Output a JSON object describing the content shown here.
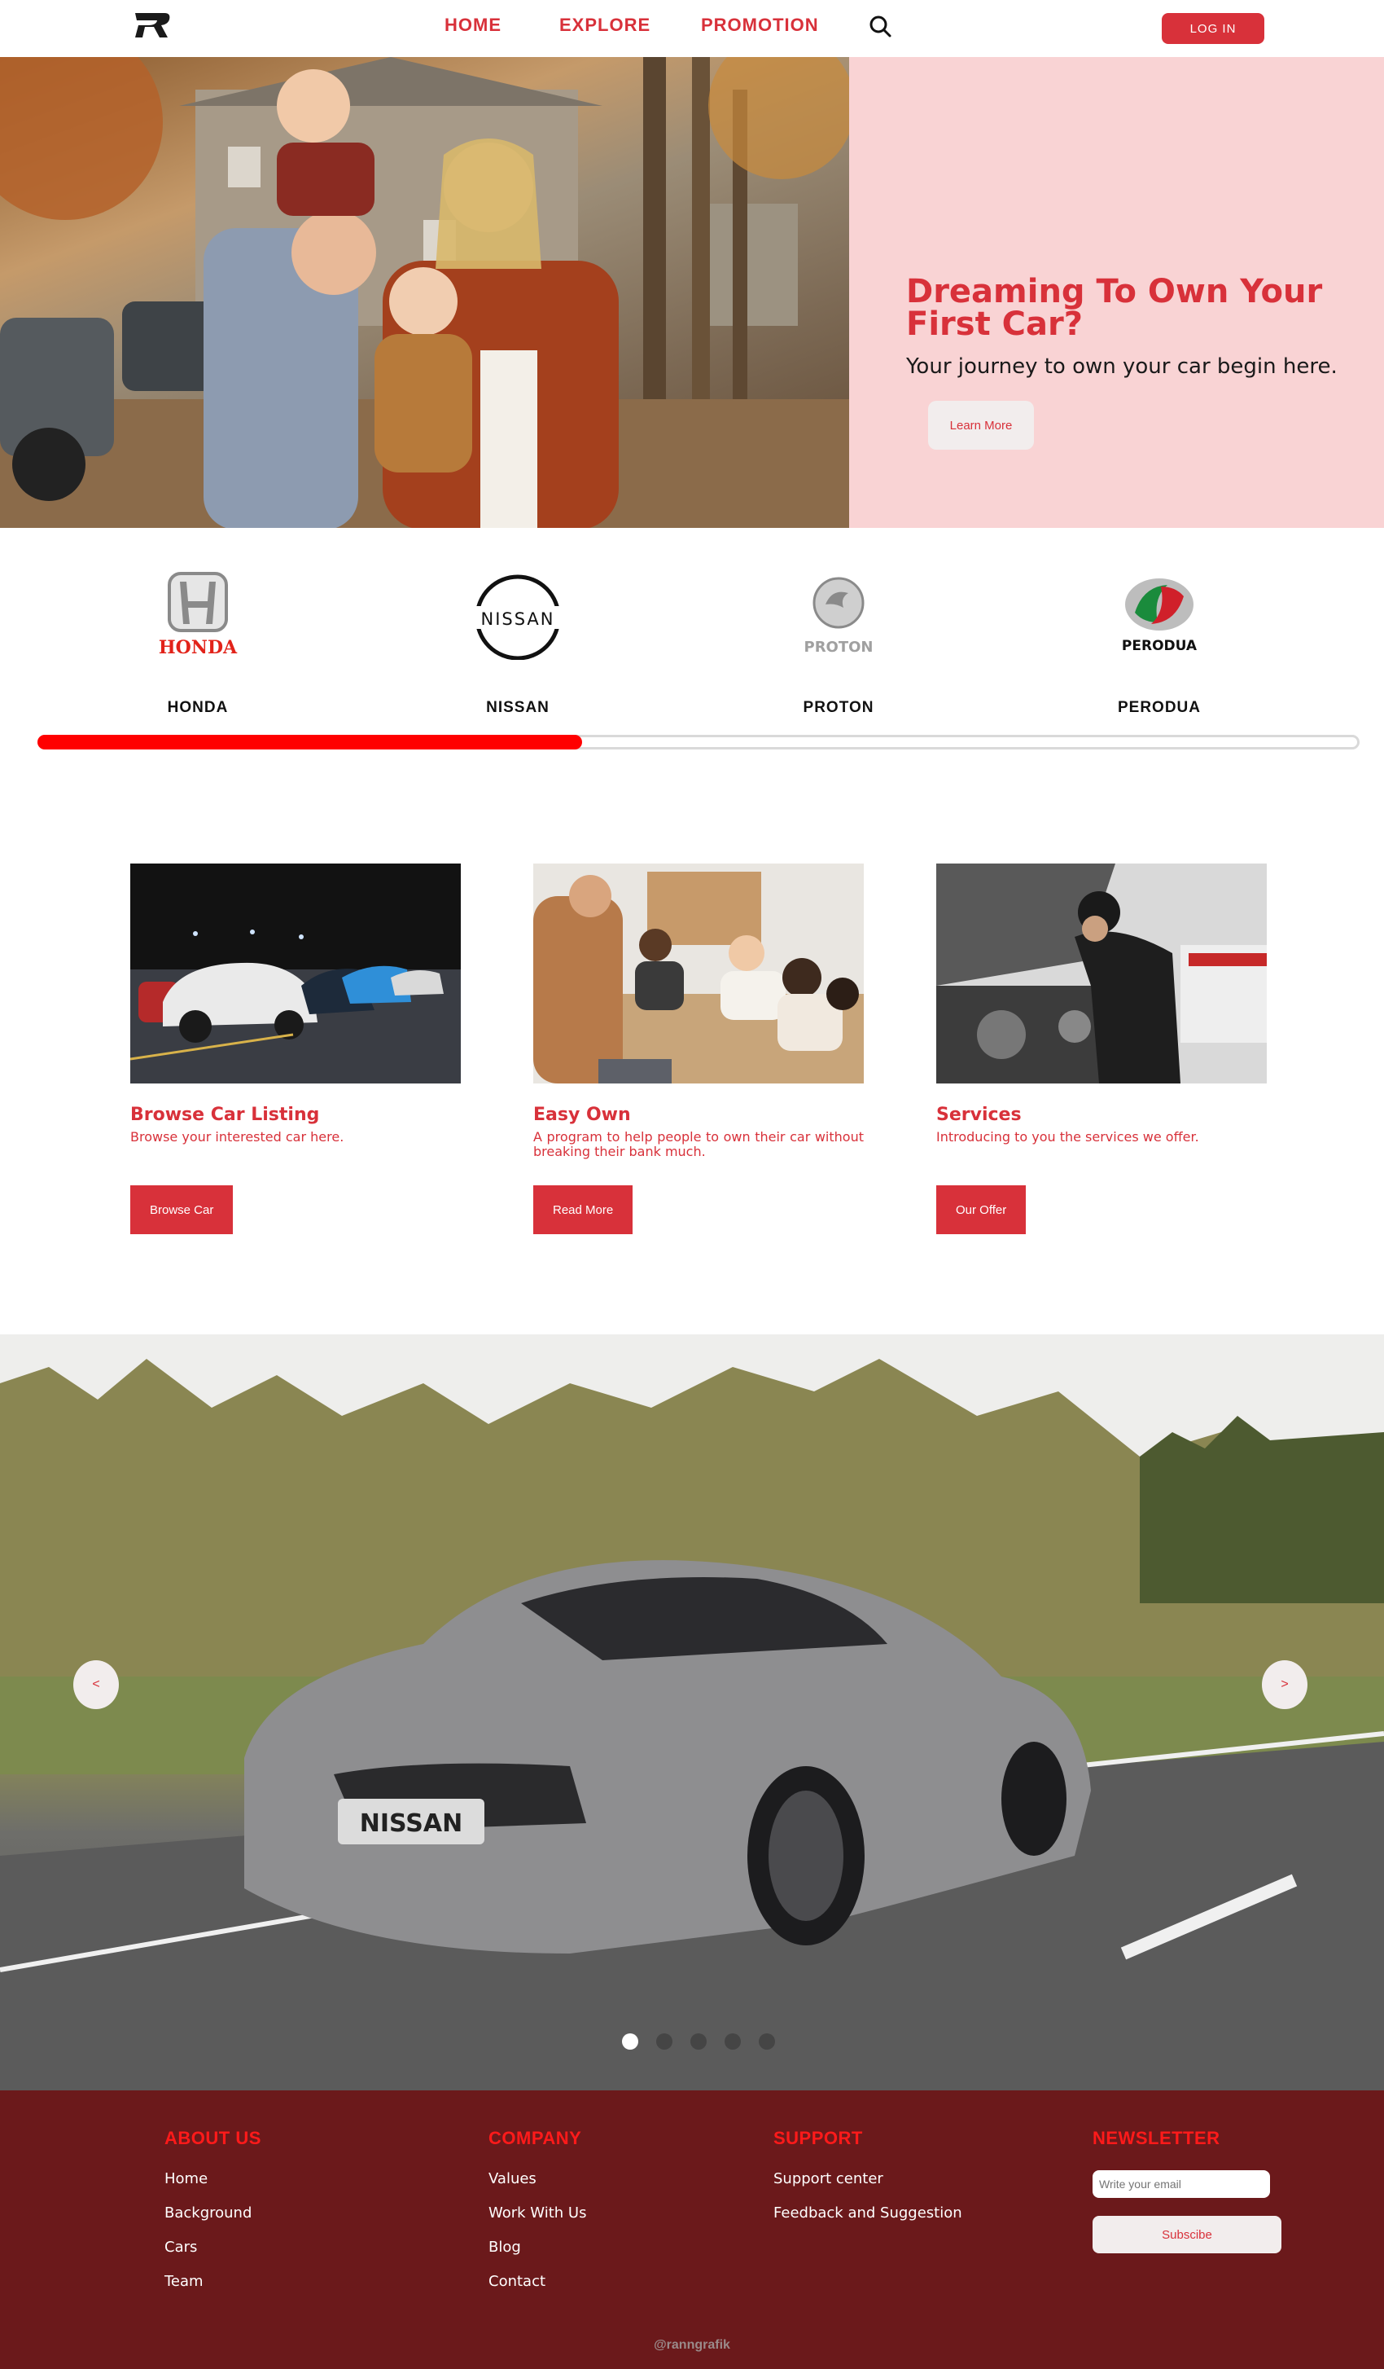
{
  "nav": {
    "home": "HOME",
    "explore": "EXPLORE",
    "promotion": "PROMOTION",
    "login": "LOG IN"
  },
  "hero": {
    "title": "Dreaming To Own Your First Car?",
    "subtitle": "Your journey to own your car begin here.",
    "button": "Learn More"
  },
  "brands": [
    {
      "name": "HONDA",
      "logo_text": "HONDA"
    },
    {
      "name": "NISSAN",
      "logo_text": "NISSAN"
    },
    {
      "name": "PROTON",
      "logo_text": "PROTON"
    },
    {
      "name": "PERODUA",
      "logo_text": "PERODUA"
    }
  ],
  "brand_progress": 0.41,
  "cards": [
    {
      "title": "Browse Car Listing",
      "desc": "Browse your interested car here.",
      "button": "Browse Car"
    },
    {
      "title": "Easy Own",
      "desc": "A program to help people to own their car without breaking their bank much.",
      "button": "Read More"
    },
    {
      "title": "Services",
      "desc": "Introducing to you the services we offer.",
      "button": "Our Offer"
    }
  ],
  "carousel": {
    "prev": "<",
    "next": ">",
    "plate": "NISSAN",
    "slide_count": 5,
    "active_slide": 1
  },
  "footer": {
    "about": {
      "heading": "ABOUT US",
      "links": [
        "Home",
        "Background",
        "Cars",
        "Team"
      ]
    },
    "company": {
      "heading": "COMPANY",
      "links": [
        "Values",
        "Work With Us",
        "Blog",
        "Contact"
      ]
    },
    "support": {
      "heading": "SUPPORT",
      "links": [
        "Support center",
        "Feedback and Suggestion"
      ]
    },
    "newsletter": {
      "heading": "NEWSLETTER",
      "placeholder": "Write your email",
      "button": "Subscibe"
    },
    "credit": "@ranngrafik"
  },
  "colors": {
    "accent": "#d8313a",
    "hero_panel": "#f9d3d4",
    "footer_bg": "#6b191b",
    "footer_heading": "#ff1a1a",
    "progress": "#ff0000"
  }
}
